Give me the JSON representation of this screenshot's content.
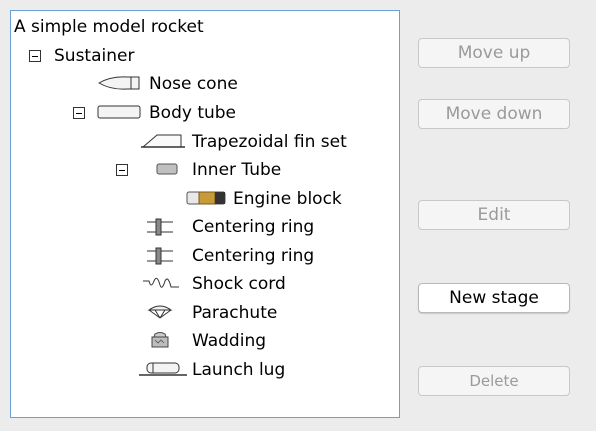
{
  "tree": {
    "root_label": "A simple model rocket",
    "nodes": [
      {
        "label": "Sustainer",
        "icon": "stage-icon"
      },
      {
        "label": "Nose cone",
        "icon": "nose-cone-icon"
      },
      {
        "label": "Body tube",
        "icon": "body-tube-icon"
      },
      {
        "label": "Trapezoidal fin set",
        "icon": "fin-set-icon"
      },
      {
        "label": "Inner Tube",
        "icon": "inner-tube-icon"
      },
      {
        "label": "Engine block",
        "icon": "engine-block-icon"
      },
      {
        "label": "Centering ring",
        "icon": "centering-ring-icon"
      },
      {
        "label": "Centering ring",
        "icon": "centering-ring-icon"
      },
      {
        "label": "Shock cord",
        "icon": "shock-cord-icon"
      },
      {
        "label": "Parachute",
        "icon": "parachute-icon"
      },
      {
        "label": "Wadding",
        "icon": "wadding-icon"
      },
      {
        "label": "Launch lug",
        "icon": "launch-lug-icon"
      }
    ]
  },
  "buttons": {
    "move_up": "Move up",
    "move_down": "Move down",
    "edit": "Edit",
    "new_stage": "New stage",
    "delete": "Delete"
  },
  "colors": {
    "panel_background": "#ececec",
    "tree_border": "#6aa0d8",
    "disabled_text": "#9a9a9a"
  }
}
